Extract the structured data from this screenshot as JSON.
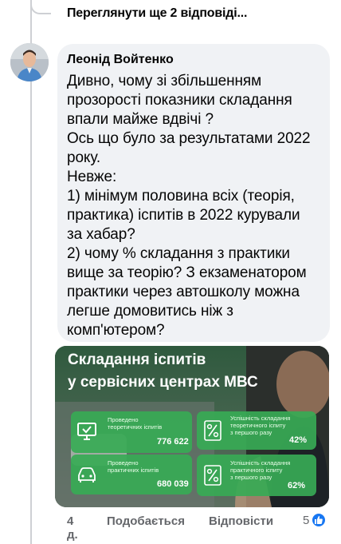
{
  "thread": {
    "more_replies_label": "Переглянути ще 2 відповіді..."
  },
  "comment": {
    "author": "Леонід Войтенко",
    "text": "Дивно, чому зі збільшенням\nпрозорості показники складання\nвпали майже вдвічі ?\nОсь що було за результатами 2022\nроку.\nНевже:\n1) мінімум половина всіх  (теорія,\nпрактика) іспитів в 2022 курували\nза хабар?\n2) чому % складання з практики\nвище за теорію? З екзаменатором\nпрактики через автошколу можна\nлегше домовитись ніж з\nкомп'ютером?"
  },
  "image": {
    "title": "Складання іспитів\nу сервісних центрах МВС",
    "stats": [
      {
        "label": "Проведено\nтеоретичних іспитів",
        "value": "776 622",
        "icon": "monitor-check-icon"
      },
      {
        "label": "Успішність складання\nтеоретичного іспиту\nз першого разу",
        "value": "42%",
        "icon": "percent-icon"
      },
      {
        "label": "Проведено\nпрактичних іспитів",
        "value": "680 039",
        "icon": "car-icon"
      },
      {
        "label": "Успішність складання\nпрактичного іспиту\nз першого разу",
        "value": "62%",
        "icon": "percent-icon"
      }
    ]
  },
  "actions": {
    "time": "4 д.",
    "like_label": "Подобається",
    "reply_label": "Відповісти",
    "reaction_count": "5"
  },
  "colors": {
    "bubble": "#f0f2f5",
    "stat_green": "#37aa55",
    "like_blue": "#1877f2",
    "meta_gray": "#65676b"
  }
}
